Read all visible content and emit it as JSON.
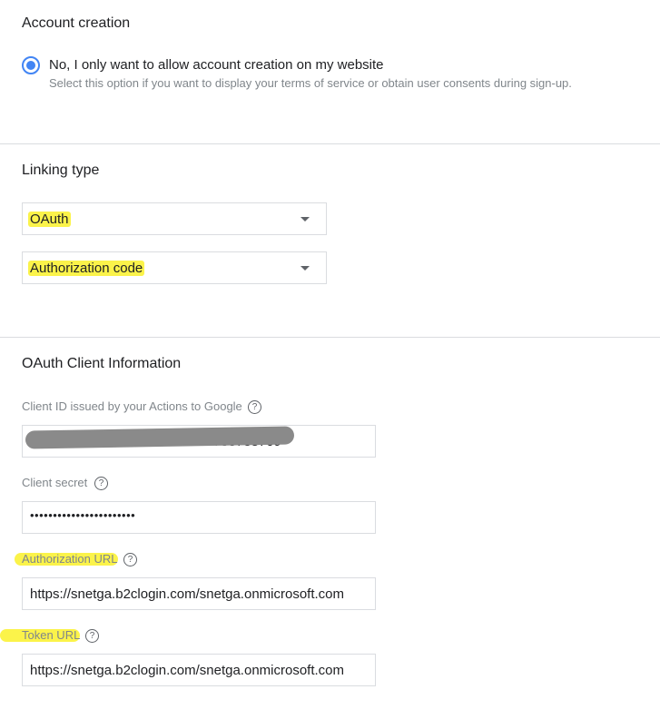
{
  "account_creation": {
    "title": "Account creation",
    "option_label": "No, I only want to allow account creation on my website",
    "option_help": "Select this option if you want to display your terms of service or obtain user consents during sign-up."
  },
  "linking_type": {
    "title": "Linking type",
    "type_value": "OAuth",
    "grant_value": "Authorization code"
  },
  "oauth": {
    "title": "OAuth Client Information",
    "client_id_label": "Client ID issued by your Actions to Google",
    "client_id_value": "e7c1a5f0-1d2b-4c3e-b0fb-d9e788788709",
    "client_secret_label": "Client secret",
    "client_secret_value": "•••••••••••••••••••••••",
    "auth_url_label": "Authorization URL",
    "auth_url_value": "https://snetga.b2clogin.com/snetga.onmicrosoft.com",
    "token_url_label": "Token URL",
    "token_url_value": "https://snetga.b2clogin.com/snetga.onmicrosoft.com"
  },
  "help_icon_glyph": "?",
  "colors": {
    "accent": "#4285f4",
    "highlight": "#fbf34a"
  }
}
